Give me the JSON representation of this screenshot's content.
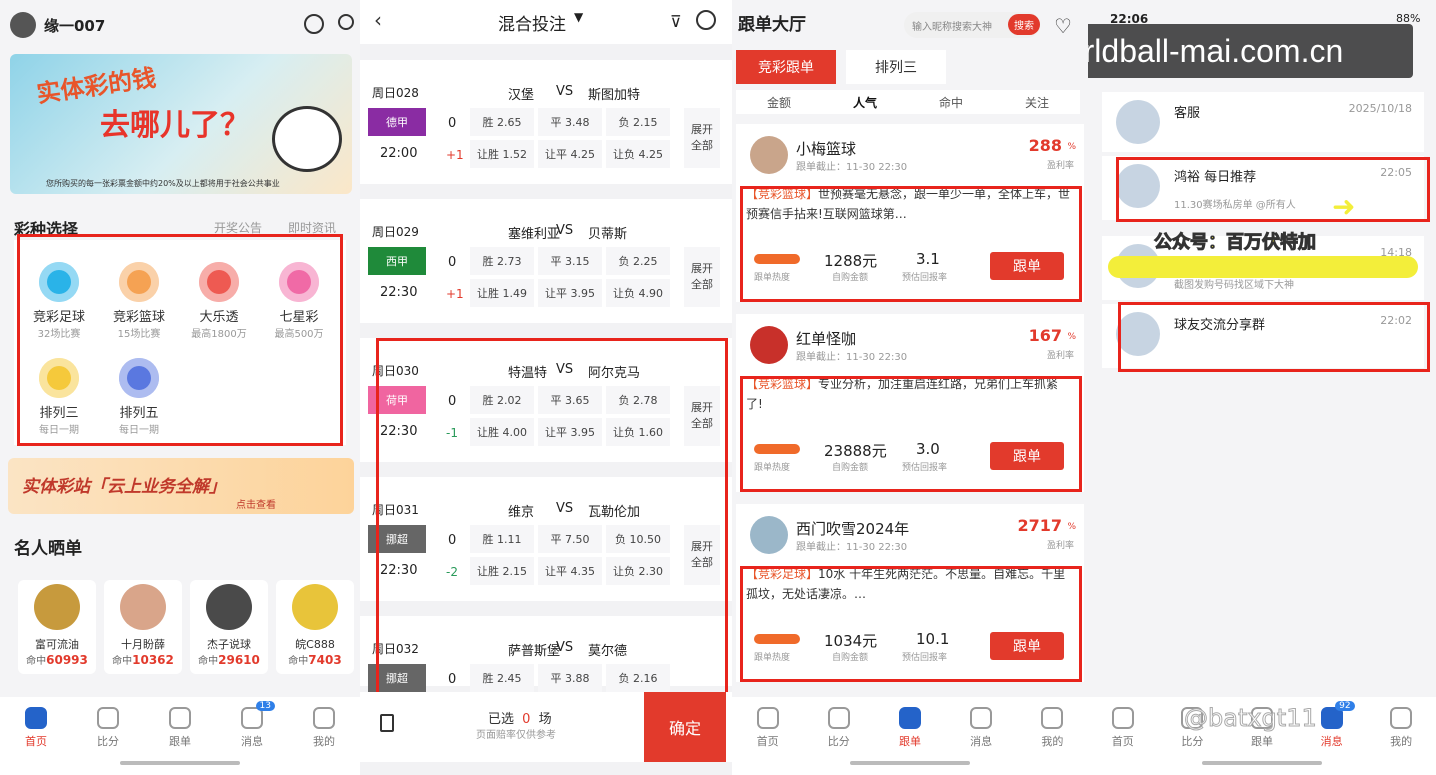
{
  "p1": {
    "username": "缘一007",
    "banner_title1": "实体彩的钱",
    "banner_title2": "去哪儿了？",
    "banner_caption": "您所购买的每一张彩票金额中约20%及以上都将用于社会公共事业",
    "section_title": "彩种选择",
    "link_announce": "开奖公告",
    "link_news": "即时资讯",
    "lotteries": [
      {
        "name": "竞彩足球",
        "sub": "32场比赛",
        "color": "#2ab3e8"
      },
      {
        "name": "竞彩篮球",
        "sub": "15场比赛",
        "color": "#f5a253"
      },
      {
        "name": "大乐透",
        "sub": "最高1800万",
        "color": "#ee5a52"
      },
      {
        "name": "七星彩",
        "sub": "最高500万",
        "color": "#f06aa6"
      },
      {
        "name": "排列三",
        "sub": "每日一期",
        "color": "#f5c93b"
      },
      {
        "name": "排列五",
        "sub": "每日一期",
        "color": "#5a78e0"
      }
    ],
    "promo_text": "实体彩站「云上业务全解」",
    "promo_link": "点击查看",
    "celeb_title": "名人晒单",
    "celebs": [
      {
        "name": "富可流油",
        "prefix": "命中",
        "value": "60993",
        "color": "#c79a3d"
      },
      {
        "name": "十月盼薛",
        "prefix": "命中",
        "value": "10362",
        "color": "#d9a58a"
      },
      {
        "name": "杰子说球",
        "prefix": "命中",
        "value": "29610",
        "color": "#4a4a4a"
      },
      {
        "name": "皖C888",
        "prefix": "命中",
        "value": "7403",
        "color": "#e8c43a"
      }
    ],
    "tabs": [
      {
        "label": "首页"
      },
      {
        "label": "比分"
      },
      {
        "label": "跟单"
      },
      {
        "label": "消息",
        "badge": "13"
      },
      {
        "label": "我的"
      }
    ]
  },
  "p2": {
    "title": "混合投注",
    "matches": [
      {
        "day": "周日028",
        "home": "汉堡",
        "away": "斯图加特",
        "league": "德甲",
        "lc": "#8a2ca3",
        "time": "22:00",
        "h1": "0",
        "h2": "+1",
        "o": [
          "胜 2.65",
          "平 3.48",
          "负 2.15",
          "让胜 1.52",
          "让平 4.25",
          "让负 4.25"
        ]
      },
      {
        "day": "周日029",
        "home": "塞维利亚",
        "away": "贝蒂斯",
        "league": "西甲",
        "lc": "#1f8a3a",
        "time": "22:30",
        "h1": "0",
        "h2": "+1",
        "o": [
          "胜 2.73",
          "平 3.15",
          "负 2.25",
          "让胜 1.49",
          "让平 3.95",
          "让负 4.90"
        ]
      },
      {
        "day": "周日030",
        "home": "特温特",
        "away": "阿尔克马",
        "league": "荷甲",
        "lc": "#f065a0",
        "time": "22:30",
        "h1": "0",
        "h2": "-1",
        "o": [
          "胜 2.02",
          "平 3.65",
          "负 2.78",
          "让胜 4.00",
          "让平 3.95",
          "让负 1.60"
        ]
      },
      {
        "day": "周日031",
        "home": "维京",
        "away": "瓦勒伦加",
        "league": "挪超",
        "lc": "#666666",
        "time": "22:30",
        "h1": "0",
        "h2": "-2",
        "o": [
          "胜 1.11",
          "平 7.50",
          "负 10.50",
          "让胜 2.15",
          "让平 4.35",
          "让负 2.30"
        ]
      },
      {
        "day": "周日032",
        "home": "萨普斯堡",
        "away": "莫尔德",
        "league": "挪超",
        "lc": "#666666",
        "time": "",
        "h1": "0",
        "h2": "",
        "o": [
          "胜 2.45",
          "平 3.88",
          "负 2.16"
        ]
      }
    ],
    "vs": "VS",
    "expand": "展开",
    "expand2": "全部",
    "selected_pre": "已选",
    "selected_count": "0",
    "selected_post": "场",
    "note": "页面赔率仅供参考",
    "confirm": "确定"
  },
  "p3": {
    "title": "跟单大厅",
    "search_placeholder": "输入昵称搜索大神",
    "search_btn": "搜索",
    "top_tabs": [
      "竞彩跟单",
      "排列三"
    ],
    "sub_tabs": [
      "金额",
      "人气",
      "命中",
      "关注"
    ],
    "cards": [
      {
        "name": "小梅篮球",
        "deadline": "跟单截止：11-30 22:30",
        "rate": "288",
        "tag": "【竞彩篮球】",
        "desc": "世预赛毫无悬念，跟一单少一单，全体上车，世预赛信手拈来!互联网篮球第…",
        "amount": "1288元",
        "return": "3.1",
        "av": "#c9a58b"
      },
      {
        "name": "红单怪咖",
        "deadline": "跟单截止：11-30 22:30",
        "rate": "167",
        "tag": "【竞彩篮球】",
        "desc": "专业分析，加注重启连红路，兄弟们上车抓紧了!",
        "amount": "23888元",
        "return": "3.0",
        "av": "#c8302a"
      },
      {
        "name": "西门吹雪2024年",
        "deadline": "跟单截止：11-30 22:30",
        "rate": "2717",
        "tag": "【竞彩足球】",
        "desc": "10水 十年生死两茫茫。不思量。自难忘。千里孤坟，无处话凄凉。…",
        "amount": "1034元",
        "return": "10.1",
        "av": "#9bb7c9"
      }
    ],
    "pct": "%",
    "rate_label": "盈利率",
    "heat_label": "跟单热度",
    "amount_label": "自购金额",
    "return_label": "预估回报率",
    "follow": "跟单",
    "tabs": [
      "首页",
      "比分",
      "跟单",
      "消息",
      "我的"
    ]
  },
  "p4": {
    "time": "22:06",
    "battery": "88%",
    "watermark": "worldball-mai.com.cn",
    "chats": [
      {
        "name": "客服",
        "time": "2025/10/18",
        "preview": ""
      },
      {
        "name": "鸿裕 每日推荐",
        "time": "22:05",
        "preview": "11.30赛场私房单 @所有人"
      },
      {
        "name": "",
        "time": "14:18",
        "preview": "截图发购号码找区域下大神"
      },
      {
        "name": "球友交流分享群",
        "time": "22:02",
        "preview": ""
      }
    ],
    "banner": "公众号：百万伏特加",
    "tabs": [
      "首页",
      "比分",
      "跟单",
      "消息",
      "我的"
    ],
    "msg_badge": "92",
    "corner_watermark": "@batxgt11"
  }
}
